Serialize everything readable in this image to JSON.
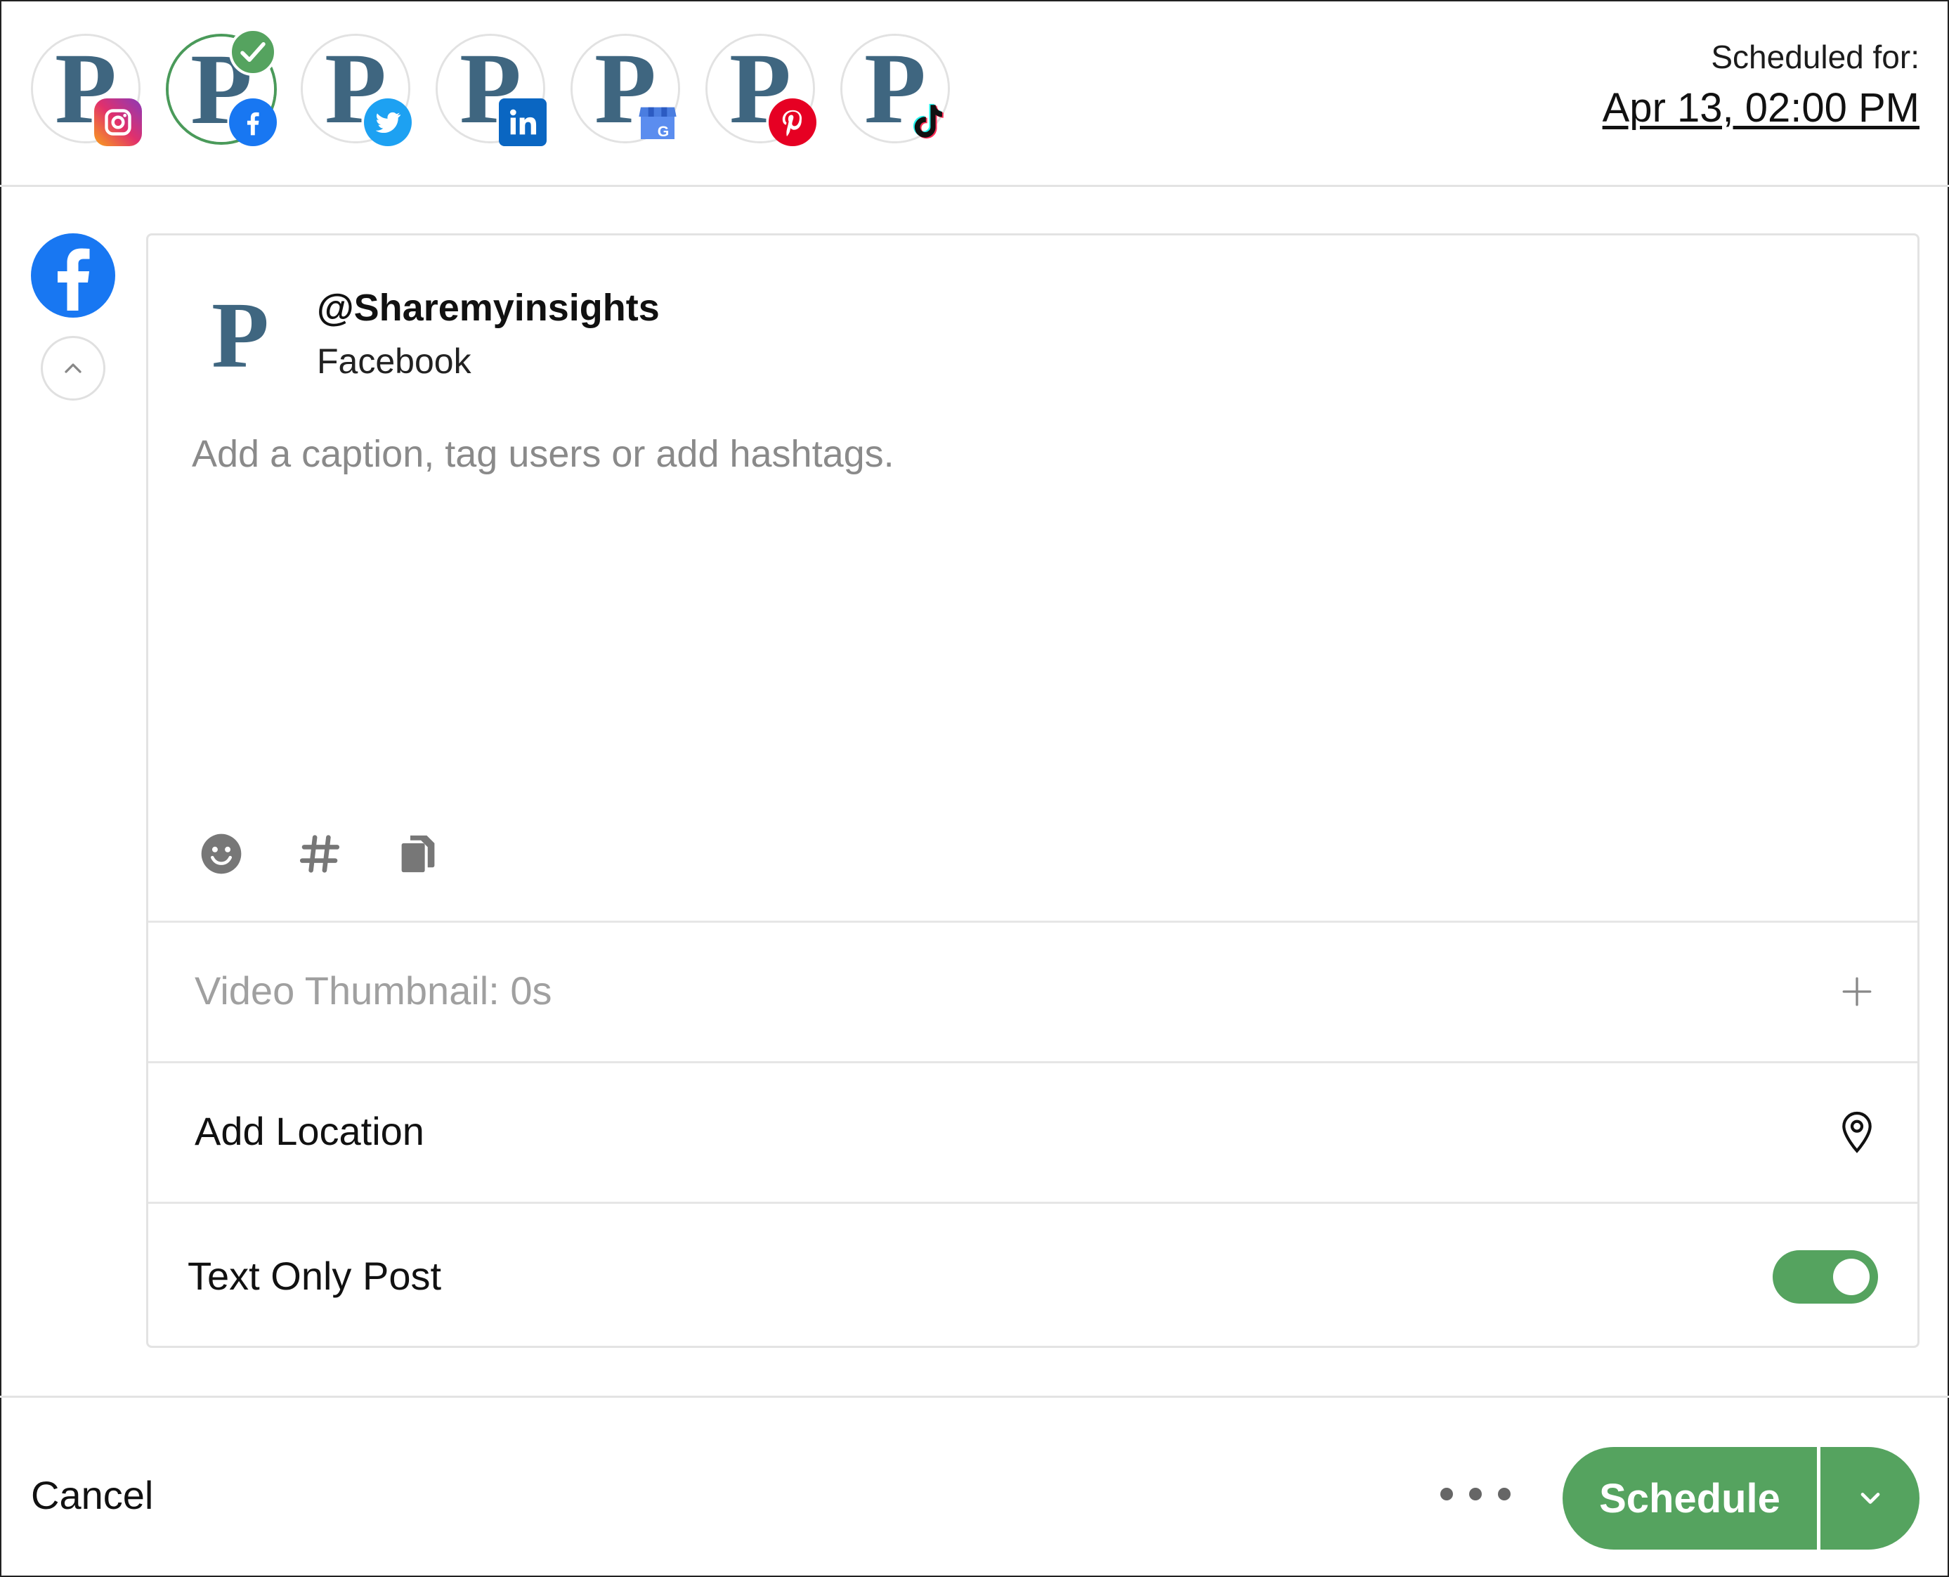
{
  "header": {
    "accounts": [
      {
        "network": "Instagram",
        "icon": "instagram-icon",
        "selected": false
      },
      {
        "network": "Facebook",
        "icon": "facebook-icon",
        "selected": true
      },
      {
        "network": "Twitter",
        "icon": "twitter-icon",
        "selected": false
      },
      {
        "network": "LinkedIn",
        "icon": "linkedin-icon",
        "selected": false
      },
      {
        "network": "Google Business",
        "icon": "google-business-icon",
        "selected": false
      },
      {
        "network": "Pinterest",
        "icon": "pinterest-icon",
        "selected": false
      },
      {
        "network": "TikTok",
        "icon": "tiktok-icon",
        "selected": false
      }
    ],
    "scheduled_label": "Scheduled for:",
    "scheduled_date": "Apr 13, 02:00 PM"
  },
  "post": {
    "handle": "@Sharemyinsights",
    "network": "Facebook",
    "caption_value": "",
    "caption_placeholder": "Add a caption, tag users or add hashtags.",
    "tools": [
      "emoji-icon",
      "hashtag-icon",
      "copy-icon"
    ],
    "video_thumbnail_label": "Video Thumbnail: 0s",
    "add_location_label": "Add Location",
    "text_only_label": "Text Only Post",
    "text_only_enabled": true
  },
  "footer": {
    "cancel_label": "Cancel",
    "schedule_label": "Schedule"
  },
  "colors": {
    "accent_green": "#55a35f",
    "facebook_blue": "#1877F2",
    "brand_slate": "#3f6680"
  }
}
